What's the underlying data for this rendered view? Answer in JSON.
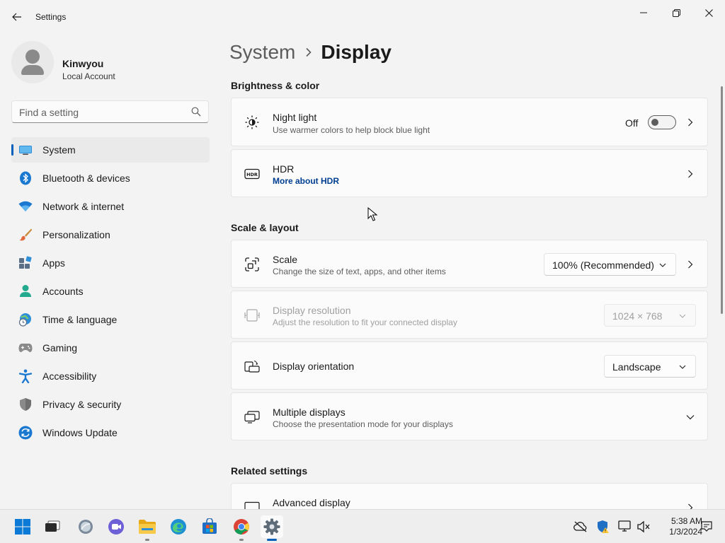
{
  "window": {
    "title": "Settings"
  },
  "profile": {
    "name": "Kinwyou",
    "account_type": "Local Account"
  },
  "search": {
    "placeholder": "Find a setting"
  },
  "nav": {
    "items": [
      {
        "label": "System",
        "icon": "system-icon",
        "active": true
      },
      {
        "label": "Bluetooth & devices",
        "icon": "bluetooth-icon"
      },
      {
        "label": "Network & internet",
        "icon": "wifi-icon"
      },
      {
        "label": "Personalization",
        "icon": "brush-icon"
      },
      {
        "label": "Apps",
        "icon": "apps-icon"
      },
      {
        "label": "Accounts",
        "icon": "accounts-icon"
      },
      {
        "label": "Time & language",
        "icon": "globe-clock-icon"
      },
      {
        "label": "Gaming",
        "icon": "gamepad-icon"
      },
      {
        "label": "Accessibility",
        "icon": "accessibility-icon"
      },
      {
        "label": "Privacy & security",
        "icon": "shield-icon"
      },
      {
        "label": "Windows Update",
        "icon": "update-icon"
      }
    ]
  },
  "breadcrumb": {
    "parent": "System",
    "current": "Display"
  },
  "sections": {
    "brightness": "Brightness & color",
    "scale_layout": "Scale & layout",
    "related": "Related settings"
  },
  "night_light": {
    "title": "Night light",
    "subtitle": "Use warmer colors to help block blue light",
    "toggle_state": "Off"
  },
  "hdr": {
    "title": "HDR",
    "link": "More about HDR"
  },
  "scale": {
    "title": "Scale",
    "subtitle": "Change the size of text, apps, and other items",
    "value": "100% (Recommended)"
  },
  "resolution": {
    "title": "Display resolution",
    "subtitle": "Adjust the resolution to fit your connected display",
    "value": "1024 × 768"
  },
  "orientation": {
    "title": "Display orientation",
    "value": "Landscape"
  },
  "multiple_displays": {
    "title": "Multiple displays",
    "subtitle": "Choose the presentation mode for your displays"
  },
  "advanced_display": {
    "title": "Advanced display"
  },
  "taskbar": {
    "time": "5:38 AM",
    "date": "1/3/2024"
  },
  "colors": {
    "accent": "#005fb8",
    "link": "#003e92"
  }
}
